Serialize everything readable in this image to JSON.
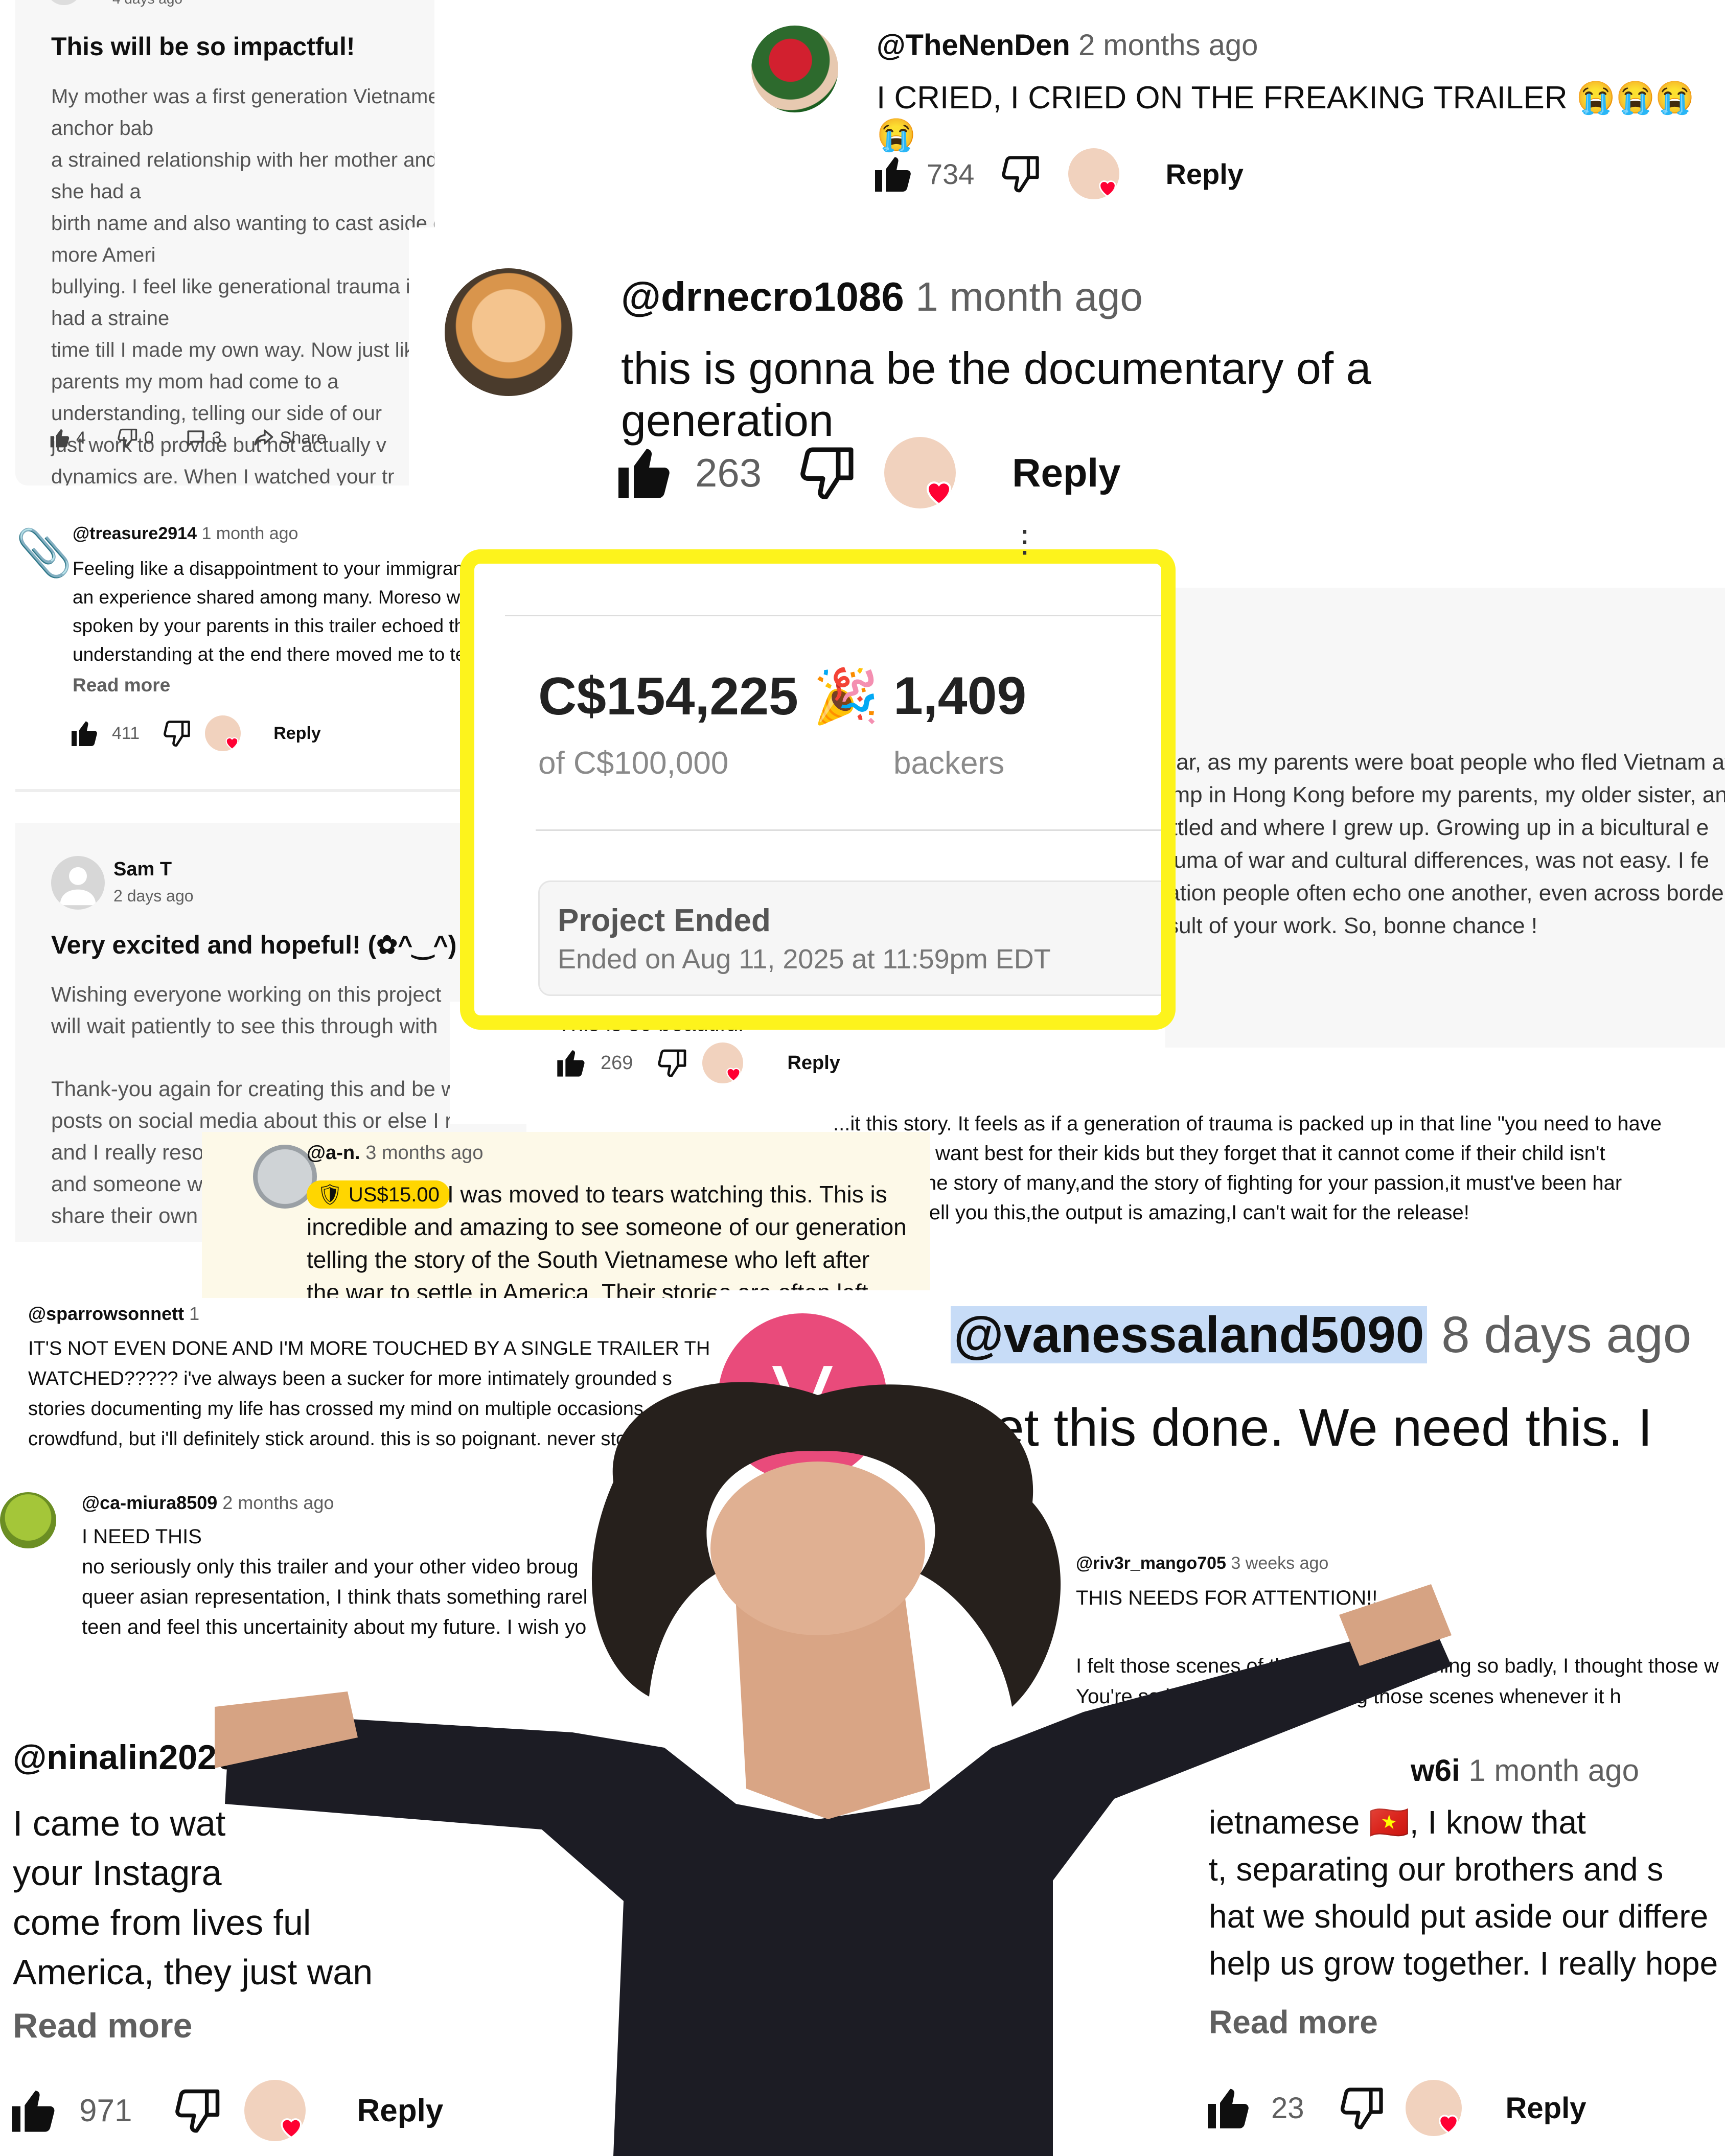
{
  "c_impactful": {
    "time": "4 days ago",
    "title": "This will be so impactful!",
    "body": "My mother was a first generation Vietnamese American, the anchor bab\na strained relationship with her mother and father. Growing up she had a\nbirth name and also wanting to cast aside our heritage for a more Ameri\nbullying. I feel like generational trauma is deep and we also had a straine\ntime till I made my own way. Now just like you and your parents my mom had come to a\nunderstanding, telling our side of our\njust work to provide but not actually v\ndynamics are. When I watched your tr\nown family and also my own pursuit in",
    "likes": "4",
    "dislikes": "0",
    "comments": "3",
    "share": "Share"
  },
  "c_nenden": {
    "handle": "@TheNenDen",
    "time": "2 months ago",
    "text": "I CRIED, I CRIED ON THE FREAKING TRAILER 😭😭😭😭",
    "likes": "734",
    "reply": "Reply"
  },
  "c_drnecro": {
    "handle": "@drnecro1086",
    "time": "1 month ago",
    "text": "this is gonna be the documentary of a generation",
    "likes": "263",
    "reply": "Reply"
  },
  "c_treasure": {
    "handle": "@treasure2914",
    "time": "1 month ago",
    "body": "Feeling like a disappointment to your immigrant family, especially when you want to pursue the arts, is\nan experience shared among many. Moreso w\nspoken by your parents in this trailer echoed th\nunderstanding at the end there moved me to te",
    "read_more": "Read more",
    "likes": "411",
    "reply": "Reply"
  },
  "kickstarter": {
    "amount": "C$154,225",
    "emoji": "🎉",
    "goal": "of C$100,000",
    "backers": "1,409",
    "backers_label": "backers",
    "status_title": "Project Ended",
    "status_sub": "Ended on Aug 11, 2025 at 11:59pm EDT",
    "highlight_color": "#fdf31c"
  },
  "c_boat": {
    "body": "milar, as my parents were boat people who fled Vietnam af\ncamp in Hong Kong before my parents, my older sister, an\nsettled and where I grew up. Growing up in a bicultural e\ntrauma of war and cultural differences, was not easy. I fe\neration people often echo one another, even across borde\nresult of your work. So, bonne chance !"
  },
  "c_samt": {
    "name": "Sam T",
    "time": "2 days ago",
    "title": "Very excited and hopeful! (✿^‿^)",
    "body1": "Wishing everyone working on this project\nwill wait patiently to see this through with",
    "body2": "Thank-you again for creating this and be w\nposts on social media about this or else I r\nand I really reso\nand someone w\nshare their own"
  },
  "c_beautiful": {
    "text": "This is so beautiful",
    "likes": "269",
    "reply": "Reply"
  },
  "c_trauma": {
    "body": "...it this story. It feels as if a generation of trauma is packed up in that line \"you need to have\nparents do want best for their kids but they forget that it cannot come if their child isn't\ns story is the story of many,and the story of fighting for your passion,it must've been har\nhis,but I'll tell you this,the output is amazing,I can't wait for the release!"
  },
  "c_an": {
    "handle": "@a-n.",
    "time": "3 months ago",
    "donation": "US$15.00",
    "body": "I was moved to tears watching this. This is\nincredible and amazing to see someone of our generation\ntelling the story of the South Vietnamese who left after\nthe war to settle in America. Their stories are often left …"
  },
  "c_sparrow": {
    "handle": "@sparrowsonnett",
    "time": "1",
    "body": "IT'S NOT EVEN DONE AND I'M MORE TOUCHED BY A SINGLE TRAILER TH\nWATCHED????? i've always been a sucker for more intimately grounded s\nstories documenting my life has crossed my mind on multiple occasions\ncrowdfund, but i'll definitely stick around. this is so poignant. never stop!!"
  },
  "c_vanessa": {
    "handle": "@vanessaland5090",
    "time": "8 days ago",
    "text": "Get this done. We need this. I",
    "avatar_letter": "V",
    "avatar_color": "#e94b7b"
  },
  "c_miura": {
    "handle": "@ca-miura8509",
    "time": "2 months ago",
    "body": "I NEED THIS\nno seriously only this trailer and your other video broug\nqueer asian representation, I think thats something rarel\nteen and feel this uncertainity about my future. I wish yo"
  },
  "c_mango": {
    "handle": "@riv3r_mango705",
    "time": "3 weeks ago",
    "title": "THIS NEEDS FOR ATTENTION!!",
    "body": "I felt those scenes of the parents screaming so badly, I thought those w\nYou're so brave for even thi...ing those scenes whenever it h"
  },
  "c_ninalin": {
    "handle": "@ninalin2020",
    "body": "I came to wat\nyour Instagra\ncome from lives ful\nAmerica, they just wan",
    "read_more": "Read more",
    "likes": "971",
    "reply": "Reply"
  },
  "c_w6i": {
    "handle": "w6i",
    "time": "1 month ago",
    "body": "ietnamese 🇻🇳, I know that\nt, separating our brothers and s\nhat we should put aside our differe\nhelp us grow together. I really hope t",
    "read_more": "Read more",
    "likes": "23",
    "reply": "Reply"
  }
}
